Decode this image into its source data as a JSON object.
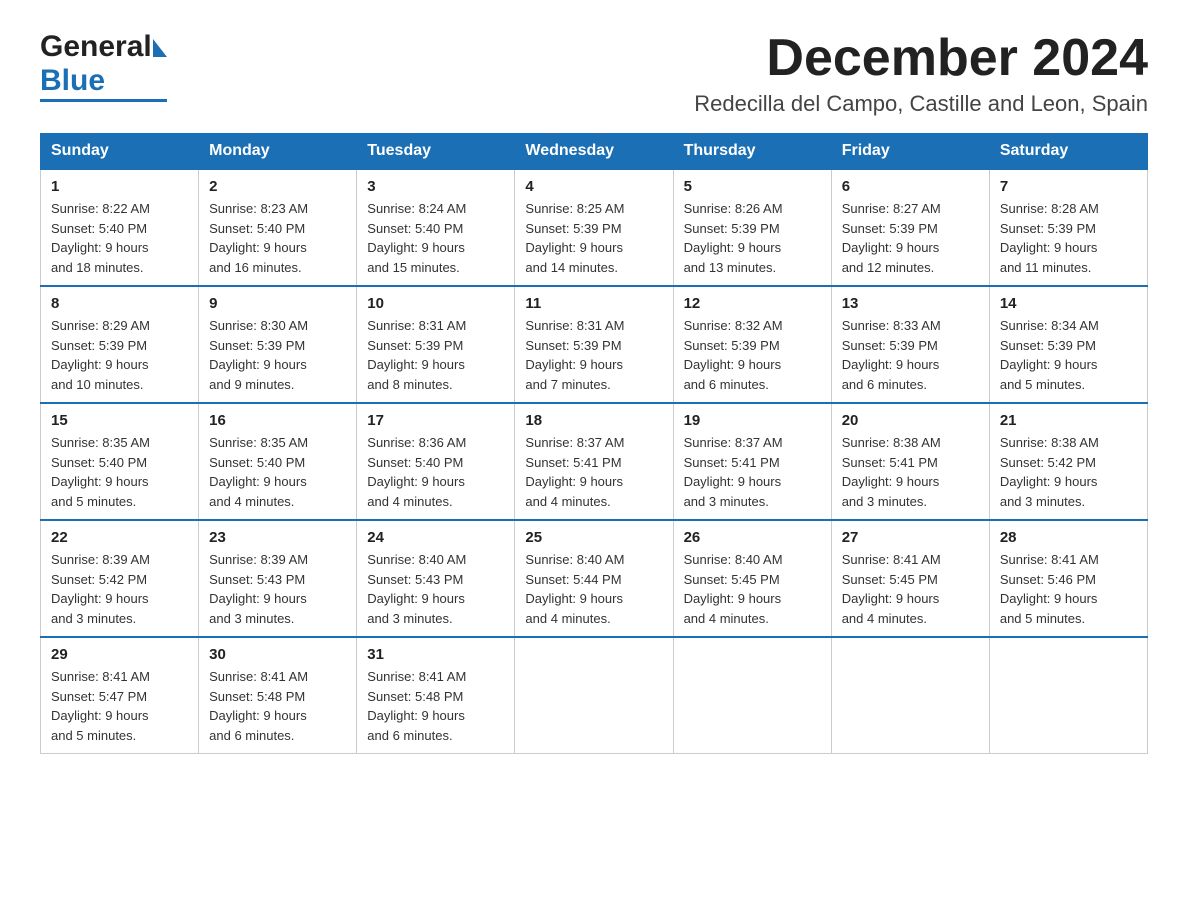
{
  "header": {
    "month_title": "December 2024",
    "location": "Redecilla del Campo, Castille and Leon, Spain",
    "logo_general": "General",
    "logo_blue": "Blue"
  },
  "days_of_week": [
    "Sunday",
    "Monday",
    "Tuesday",
    "Wednesday",
    "Thursday",
    "Friday",
    "Saturday"
  ],
  "weeks": [
    [
      {
        "day": "1",
        "sunrise": "8:22 AM",
        "sunset": "5:40 PM",
        "daylight": "9 hours and 18 minutes."
      },
      {
        "day": "2",
        "sunrise": "8:23 AM",
        "sunset": "5:40 PM",
        "daylight": "9 hours and 16 minutes."
      },
      {
        "day": "3",
        "sunrise": "8:24 AM",
        "sunset": "5:40 PM",
        "daylight": "9 hours and 15 minutes."
      },
      {
        "day": "4",
        "sunrise": "8:25 AM",
        "sunset": "5:39 PM",
        "daylight": "9 hours and 14 minutes."
      },
      {
        "day": "5",
        "sunrise": "8:26 AM",
        "sunset": "5:39 PM",
        "daylight": "9 hours and 13 minutes."
      },
      {
        "day": "6",
        "sunrise": "8:27 AM",
        "sunset": "5:39 PM",
        "daylight": "9 hours and 12 minutes."
      },
      {
        "day": "7",
        "sunrise": "8:28 AM",
        "sunset": "5:39 PM",
        "daylight": "9 hours and 11 minutes."
      }
    ],
    [
      {
        "day": "8",
        "sunrise": "8:29 AM",
        "sunset": "5:39 PM",
        "daylight": "9 hours and 10 minutes."
      },
      {
        "day": "9",
        "sunrise": "8:30 AM",
        "sunset": "5:39 PM",
        "daylight": "9 hours and 9 minutes."
      },
      {
        "day": "10",
        "sunrise": "8:31 AM",
        "sunset": "5:39 PM",
        "daylight": "9 hours and 8 minutes."
      },
      {
        "day": "11",
        "sunrise": "8:31 AM",
        "sunset": "5:39 PM",
        "daylight": "9 hours and 7 minutes."
      },
      {
        "day": "12",
        "sunrise": "8:32 AM",
        "sunset": "5:39 PM",
        "daylight": "9 hours and 6 minutes."
      },
      {
        "day": "13",
        "sunrise": "8:33 AM",
        "sunset": "5:39 PM",
        "daylight": "9 hours and 6 minutes."
      },
      {
        "day": "14",
        "sunrise": "8:34 AM",
        "sunset": "5:39 PM",
        "daylight": "9 hours and 5 minutes."
      }
    ],
    [
      {
        "day": "15",
        "sunrise": "8:35 AM",
        "sunset": "5:40 PM",
        "daylight": "9 hours and 5 minutes."
      },
      {
        "day": "16",
        "sunrise": "8:35 AM",
        "sunset": "5:40 PM",
        "daylight": "9 hours and 4 minutes."
      },
      {
        "day": "17",
        "sunrise": "8:36 AM",
        "sunset": "5:40 PM",
        "daylight": "9 hours and 4 minutes."
      },
      {
        "day": "18",
        "sunrise": "8:37 AM",
        "sunset": "5:41 PM",
        "daylight": "9 hours and 4 minutes."
      },
      {
        "day": "19",
        "sunrise": "8:37 AM",
        "sunset": "5:41 PM",
        "daylight": "9 hours and 3 minutes."
      },
      {
        "day": "20",
        "sunrise": "8:38 AM",
        "sunset": "5:41 PM",
        "daylight": "9 hours and 3 minutes."
      },
      {
        "day": "21",
        "sunrise": "8:38 AM",
        "sunset": "5:42 PM",
        "daylight": "9 hours and 3 minutes."
      }
    ],
    [
      {
        "day": "22",
        "sunrise": "8:39 AM",
        "sunset": "5:42 PM",
        "daylight": "9 hours and 3 minutes."
      },
      {
        "day": "23",
        "sunrise": "8:39 AM",
        "sunset": "5:43 PM",
        "daylight": "9 hours and 3 minutes."
      },
      {
        "day": "24",
        "sunrise": "8:40 AM",
        "sunset": "5:43 PM",
        "daylight": "9 hours and 3 minutes."
      },
      {
        "day": "25",
        "sunrise": "8:40 AM",
        "sunset": "5:44 PM",
        "daylight": "9 hours and 4 minutes."
      },
      {
        "day": "26",
        "sunrise": "8:40 AM",
        "sunset": "5:45 PM",
        "daylight": "9 hours and 4 minutes."
      },
      {
        "day": "27",
        "sunrise": "8:41 AM",
        "sunset": "5:45 PM",
        "daylight": "9 hours and 4 minutes."
      },
      {
        "day": "28",
        "sunrise": "8:41 AM",
        "sunset": "5:46 PM",
        "daylight": "9 hours and 5 minutes."
      }
    ],
    [
      {
        "day": "29",
        "sunrise": "8:41 AM",
        "sunset": "5:47 PM",
        "daylight": "9 hours and 5 minutes."
      },
      {
        "day": "30",
        "sunrise": "8:41 AM",
        "sunset": "5:48 PM",
        "daylight": "9 hours and 6 minutes."
      },
      {
        "day": "31",
        "sunrise": "8:41 AM",
        "sunset": "5:48 PM",
        "daylight": "9 hours and 6 minutes."
      },
      null,
      null,
      null,
      null
    ]
  ],
  "labels": {
    "sunrise": "Sunrise:",
    "sunset": "Sunset:",
    "daylight": "Daylight:"
  }
}
